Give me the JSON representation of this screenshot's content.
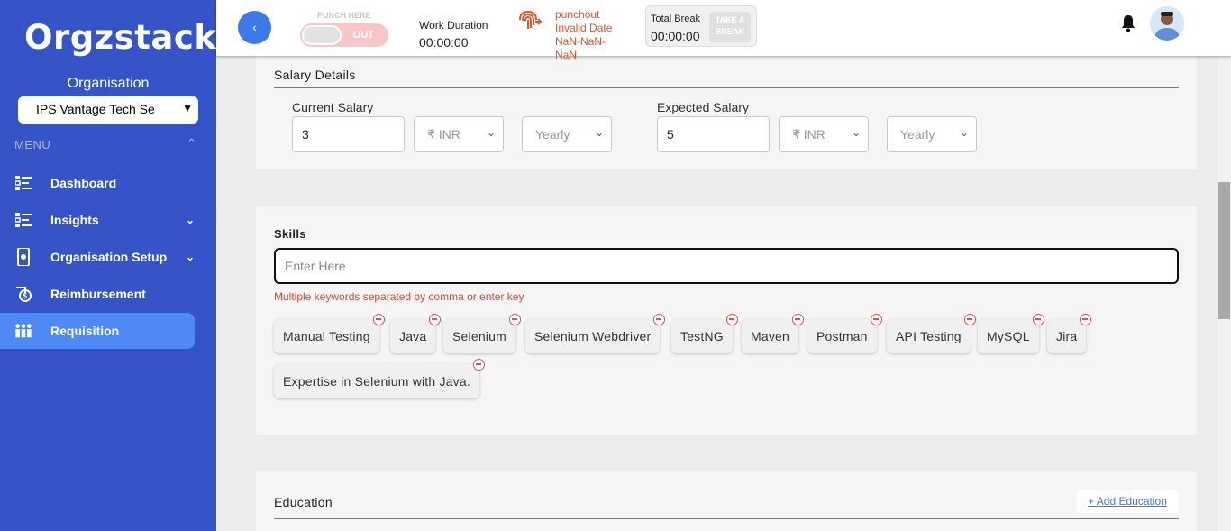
{
  "sidebar": {
    "logo": "Orgzstack",
    "org_title": "Organisation",
    "org_select_value": "IPS Vantage Tech Se",
    "menu_label": "MENU",
    "items": [
      {
        "label": "Dashboard",
        "icon": "dashboard-icon"
      },
      {
        "label": "Insights",
        "icon": "insights-icon"
      },
      {
        "label": "Organisation Setup",
        "icon": "org-setup-icon"
      },
      {
        "label": "Reimbursement",
        "icon": "reimbursement-icon"
      },
      {
        "label": "Requisition",
        "icon": "requisition-icon"
      }
    ]
  },
  "topbar": {
    "back_icon": "‹",
    "punch_here": "PUNCH HERE",
    "punch_state": "OUT",
    "work_duration_label": "Work Duration",
    "work_duration_value": "00:00:00",
    "punch_status_1": "punchout",
    "punch_status_2": "Invalid Date",
    "punch_status_3": "NaN-NaN-NaN",
    "total_break_label": "Total Break",
    "total_break_value": "00:00:00",
    "take_break": "TAKE A BREAK"
  },
  "salary": {
    "title": "Salary Details",
    "current_label": "Current Salary",
    "current_value": "3",
    "current_currency": "₹ INR",
    "current_period": "Yearly",
    "expected_label": "Expected Salary",
    "expected_value": "5",
    "expected_currency": "₹ INR",
    "expected_period": "Yearly"
  },
  "skills": {
    "title": "Skills",
    "placeholder": "Enter Here",
    "hint": "Multiple keywords separated by comma or enter key",
    "chips": [
      "Manual Testing",
      "Java",
      "Selenium",
      "Selenium Webdriver",
      "TestNG",
      "Maven",
      "Postman",
      "API Testing",
      "MySQL",
      "Jira",
      "Expertise in Selenium with Java."
    ]
  },
  "education": {
    "title": "Education",
    "add_label": "+ Add Education"
  },
  "colors": {
    "sidebar": "#3454c8",
    "active_nav": "#4f89f5",
    "accent": "#3b7be8",
    "punch_status": "#e0542a"
  }
}
